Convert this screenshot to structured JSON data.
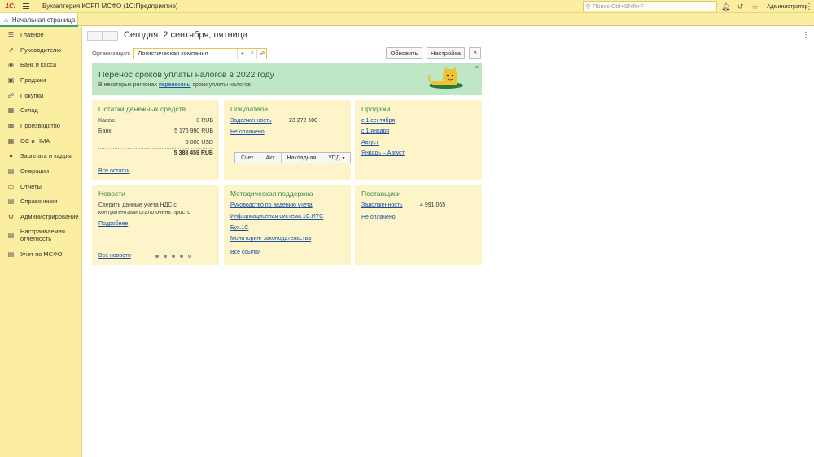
{
  "titlebar": {
    "logo": "1С:",
    "app_title": "Бухгалтерия КОРП МСФО  (1С:Предприятие)",
    "search_placeholder": "Поиск Ctrl+Shift+F",
    "user": "Администратор"
  },
  "tabs": [
    {
      "label": "Начальная страница"
    }
  ],
  "sidebar": {
    "items": [
      {
        "label": "Главное",
        "icon": "list-icon"
      },
      {
        "label": "Руководителю",
        "icon": "trend-icon"
      },
      {
        "label": "Банк и касса",
        "icon": "bank-icon"
      },
      {
        "label": "Продажи",
        "icon": "sales-icon"
      },
      {
        "label": "Покупки",
        "icon": "cart-icon"
      },
      {
        "label": "Склад",
        "icon": "warehouse-icon"
      },
      {
        "label": "Производство",
        "icon": "factory-icon"
      },
      {
        "label": "ОС и НМА",
        "icon": "assets-icon"
      },
      {
        "label": "Зарплата и кадры",
        "icon": "person-icon"
      },
      {
        "label": "Операции",
        "icon": "operations-icon"
      },
      {
        "label": "Отчеты",
        "icon": "reports-icon"
      },
      {
        "label": "Справочники",
        "icon": "books-icon"
      },
      {
        "label": "Администрирование",
        "icon": "gear-icon"
      },
      {
        "label": "Настраиваемая отчетность",
        "icon": "custom-report-icon"
      },
      {
        "label": "Учет по МСФО",
        "icon": "ifrs-icon"
      }
    ]
  },
  "main": {
    "title": "Сегодня: 2 сентября, пятница",
    "org_label": "Организация:",
    "org_value": "Логистическая компания",
    "refresh_label": "Обновить",
    "settings_label": "Настройка",
    "help_label": "?"
  },
  "banner": {
    "title": "Перенос сроков уплаты налогов в 2022 году",
    "sub_before": "В некоторых регионах ",
    "sub_link": "перенесены",
    "sub_after": " сроки уплаты налогов",
    "close": "×"
  },
  "cash": {
    "title": "Остатки денежных средств",
    "kassa_label": "Касса:",
    "kassa_value": "0 RUB",
    "bank_label": "Банк:",
    "bank_value": "5 176 990 RUB",
    "usd_value": "6 000 USD",
    "total_value": "5 388 459 RUB",
    "link": "Все остатки"
  },
  "buyers": {
    "title": "Покупатели",
    "debt_label": "Задолженность",
    "debt_value": "23 272 600",
    "unpaid_link": "Не оплачено",
    "docs": [
      "Счет",
      "Акт",
      "Накладная",
      "УПД"
    ]
  },
  "sales": {
    "title": "Продажи",
    "links": [
      "с 1 сентября",
      "с 1 января",
      "Август",
      "Январь – Август"
    ]
  },
  "news": {
    "title": "Новости",
    "text": "Сверить данные учета НДС с контрагентами стало очень просто",
    "more_link": "Подробнее",
    "all_link": "Все новости",
    "pages": 5,
    "current": 5
  },
  "support": {
    "title": "Методическая поддержка",
    "links": [
      "Руководство по ведению учета",
      "Информационная система 1С:ИТС",
      "Бух.1С",
      "Мониторинг законодательства"
    ],
    "all_link": "Все ссылки"
  },
  "suppliers": {
    "title": "Поставщики",
    "debt_label": "Задолженность",
    "debt_value": "4 991 065",
    "unpaid_link": "Не оплачено"
  }
}
